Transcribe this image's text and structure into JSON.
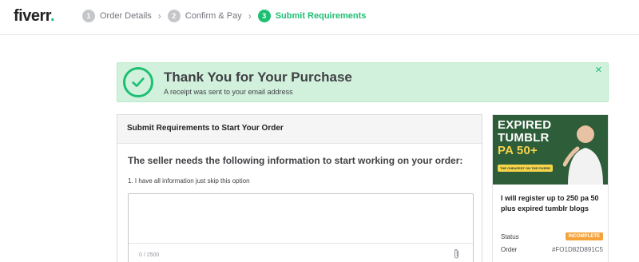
{
  "header": {
    "logo_text": "fiverr",
    "logo_dot": ".",
    "steps": [
      {
        "num": "1",
        "label": "Order Details"
      },
      {
        "num": "2",
        "label": "Confirm & Pay"
      },
      {
        "num": "3",
        "label": "Submit Requirements"
      }
    ]
  },
  "banner": {
    "title": "Thank You for Your Purchase",
    "subtitle": "A receipt was sent to your email address",
    "close": "✕"
  },
  "requirements": {
    "header": "Submit Requirements to Start Your Order",
    "title": "The seller needs the following information to start working on your order:",
    "question": "1. I have all information just skip this option",
    "textarea_value": "",
    "char_count": "0 / 2500"
  },
  "gig": {
    "thumb_line1": "EXPIRED",
    "thumb_line2": "TUMBLR",
    "thumb_line3": "PA 50+",
    "thumb_tag": "THE CHEAPEST ON THE FIVERR",
    "title": "I will register up to 250 pa 50 plus expired tumblr blogs",
    "status_label": "Status",
    "status_value": "INCOMPLETE",
    "order_label": "Order",
    "order_value": "#FO1D82D891C5"
  },
  "colors": {
    "brand_green": "#1dbf73",
    "banner_bg": "#d1f1dd",
    "status_orange": "#f6a23a"
  }
}
